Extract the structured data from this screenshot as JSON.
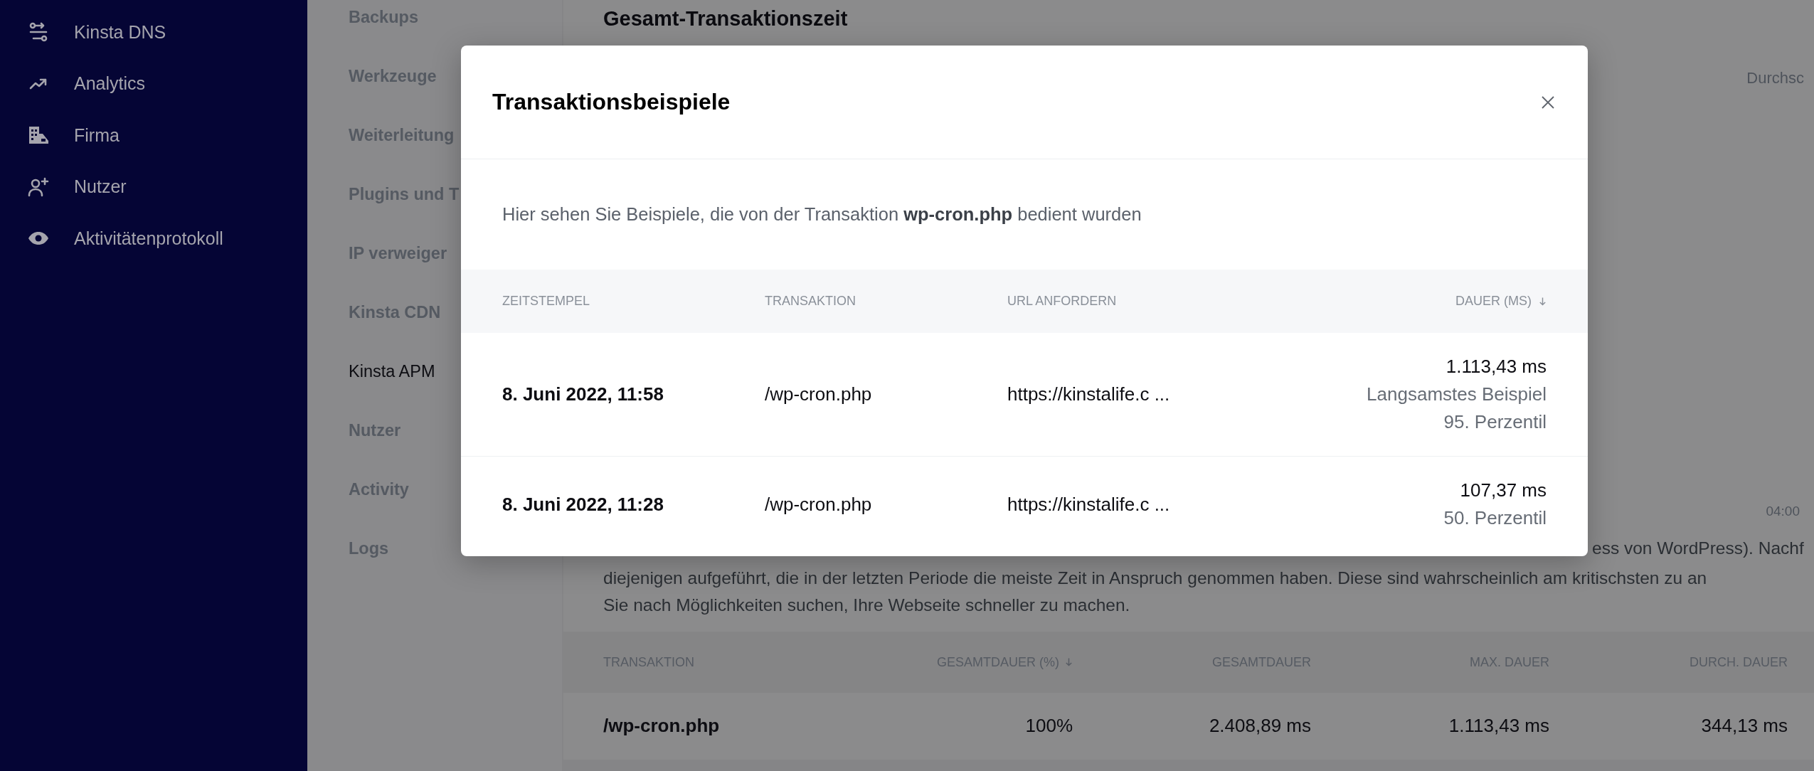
{
  "sidebar": {
    "items": [
      {
        "label": "Kinsta DNS"
      },
      {
        "label": "Analytics"
      },
      {
        "label": "Firma"
      },
      {
        "label": "Nutzer"
      },
      {
        "label": "Aktivitätenprotokoll"
      }
    ]
  },
  "subnav": {
    "items": [
      {
        "label": "Backups",
        "selected": false
      },
      {
        "label": "Werkzeuge",
        "selected": false
      },
      {
        "label": "Weiterleitung",
        "selected": false
      },
      {
        "label": "Plugins und T",
        "selected": false
      },
      {
        "label": "IP verweiger",
        "selected": false
      },
      {
        "label": "Kinsta CDN",
        "selected": false
      },
      {
        "label": "Kinsta APM",
        "selected": true
      },
      {
        "label": "Nutzer",
        "selected": false
      },
      {
        "label": "Activity",
        "selected": false
      },
      {
        "label": "Logs",
        "selected": false
      }
    ]
  },
  "main": {
    "title": "Gesamt-Transaktionszeit",
    "chart_label_top": "Durchsc",
    "chart_axis_label": "04:00",
    "description_lines": [
      "ess von WordPress). Nachf",
      "diejenigen aufgeführt, die in der letzten Periode die meiste Zeit in Anspruch genommen haben. Diese sind wahrscheinlich am kritischsten zu an",
      "Sie nach Möglichkeiten suchen, Ihre Webseite schneller zu machen."
    ],
    "table": {
      "columns": [
        {
          "label": "TRANSAKTION",
          "sorted": false
        },
        {
          "label": "GESAMTDAUER (%)",
          "sorted": true
        },
        {
          "label": "GESAMTDAUER",
          "sorted": false
        },
        {
          "label": "MAX. DAUER",
          "sorted": false
        },
        {
          "label": "DURCH. DAUER",
          "sorted": false
        }
      ],
      "rows": [
        {
          "cells": [
            "/wp-cron.php",
            "100%",
            "2.408,89 ms",
            "1.113,43 ms",
            "344,13 ms"
          ]
        }
      ]
    }
  },
  "modal": {
    "title": "Transaktionsbeispiele",
    "intro": "Hier sehen Sie Beispiele, die von der Transaktion **wp-cron.php** bedient wurden",
    "columns": [
      {
        "label": "ZEITSTEMPEL",
        "sorted": false
      },
      {
        "label": "TRANSAKTION",
        "sorted": false
      },
      {
        "label": "URL ANFORDERN",
        "sorted": false
      },
      {
        "label": "DAUER (MS)",
        "sorted": true
      }
    ],
    "rows": [
      {
        "timestamp": "8. Juni 2022, 11:58",
        "transaction": "/wp-cron.php",
        "url": "https://kinstalife.c ...",
        "duration": "1.113,43 ms",
        "notes": [
          "Langsamstes Beispiel",
          "95. Perzentil"
        ]
      },
      {
        "timestamp": "8. Juni 2022, 11:28",
        "transaction": "/wp-cron.php",
        "url": "https://kinstalife.c ...",
        "duration": "107,37 ms",
        "notes": [
          "50. Perzentil"
        ]
      }
    ]
  }
}
